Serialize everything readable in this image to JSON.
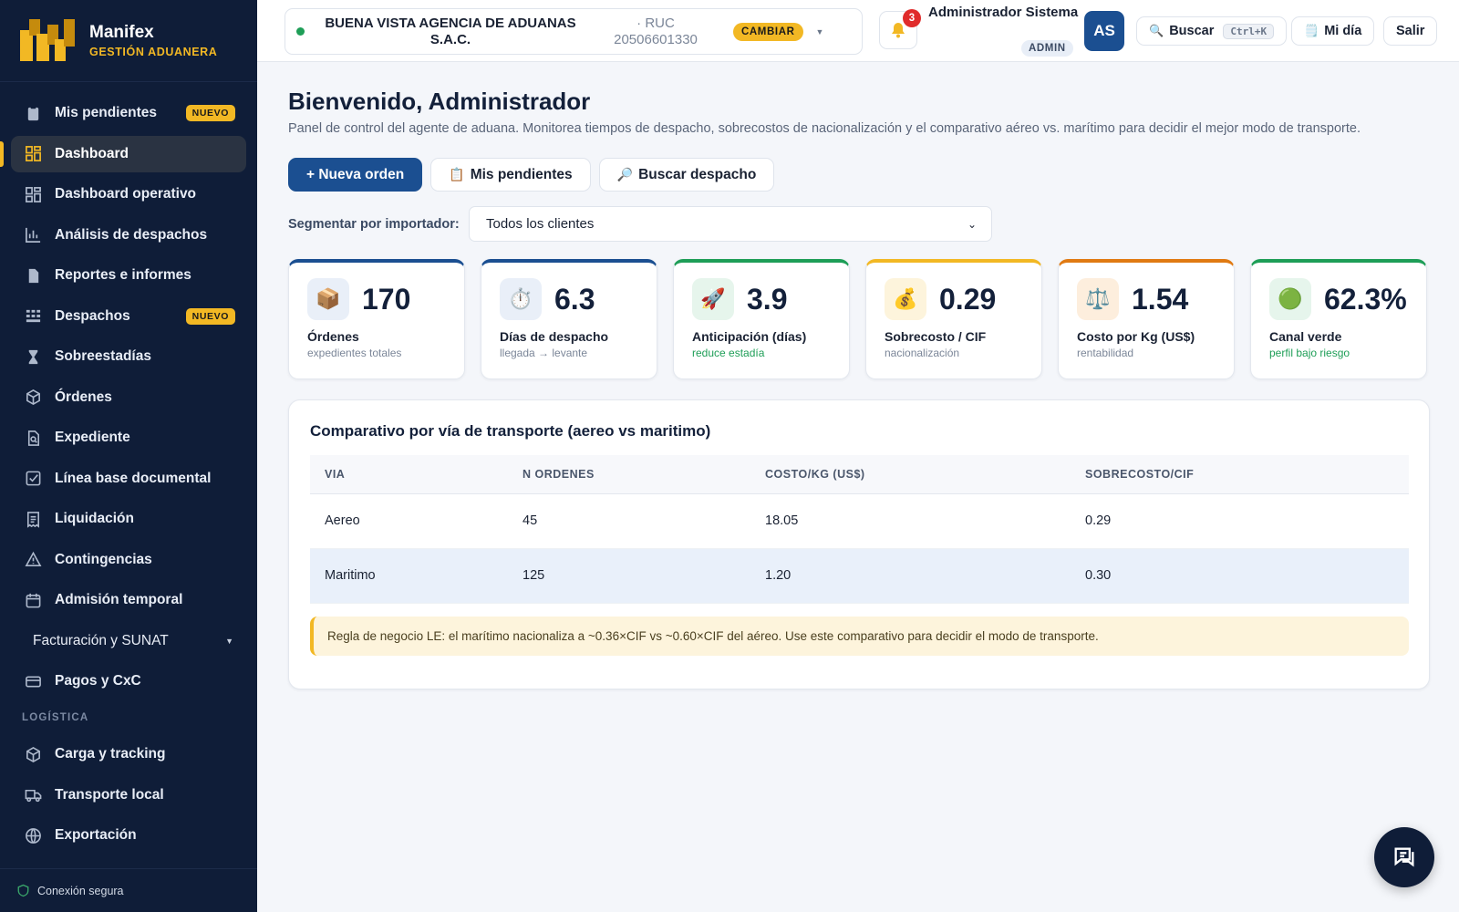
{
  "brand": {
    "name": "Manifex",
    "subtitle": "GESTIÓN ADUANERA"
  },
  "sidebar": {
    "items": [
      {
        "label": "Mis pendientes",
        "icon": "clipboard-icon",
        "badge": "NUEVO"
      },
      {
        "label": "Dashboard",
        "icon": "grid-icon",
        "active": true
      },
      {
        "label": "Dashboard operativo",
        "icon": "grid-icon"
      },
      {
        "label": "Análisis de despachos",
        "icon": "bar-chart-icon"
      },
      {
        "label": "Reportes e informes",
        "icon": "document-icon"
      },
      {
        "label": "Despachos",
        "icon": "boxes-icon",
        "badge": "NUEVO"
      },
      {
        "label": "Sobreestadías",
        "icon": "hourglass-icon"
      },
      {
        "label": "Órdenes",
        "icon": "cube-icon"
      },
      {
        "label": "Expediente",
        "icon": "file-search-icon"
      },
      {
        "label": "Línea base documental",
        "icon": "checkbox-icon"
      },
      {
        "label": "Liquidación",
        "icon": "receipt-icon"
      },
      {
        "label": "Contingencias",
        "icon": "warning-icon"
      },
      {
        "label": "Admisión temporal",
        "icon": "calendar-icon"
      }
    ],
    "submenu": {
      "label": "Facturación y SUNAT"
    },
    "payments": {
      "label": "Pagos y CxC",
      "icon": "credit-card-icon"
    },
    "section_logistics": "LOGÍSTICA",
    "logistics_items": [
      {
        "label": "Carga y tracking",
        "icon": "cube-icon"
      },
      {
        "label": "Transporte local",
        "icon": "truck-icon"
      },
      {
        "label": "Exportación",
        "icon": "globe-icon"
      }
    ],
    "footer": "Conexión segura"
  },
  "topbar": {
    "client_name": "BUENA VISTA AGENCIA DE ADUANAS S.A.C.",
    "client_ruc": "· RUC 20506601330",
    "change_label": "CAMBIAR",
    "notifications": "3",
    "user_name": "Administrador Sistema",
    "user_role": "ADMIN",
    "avatar": "AS",
    "search_label": "Buscar",
    "search_shortcut": "Ctrl+K",
    "myday_label": "Mi día",
    "logout_label": "Salir"
  },
  "page": {
    "title": "Bienvenido, Administrador",
    "subtitle": "Panel de control del agente de aduana. Monitorea tiempos de despacho, sobrecostos de nacionalización y el comparativo aéreo vs. marítimo para decidir el mejor modo de transporte.",
    "actions": {
      "new_order": "+ Nueva orden",
      "pending": "Mis pendientes",
      "search": "Buscar despacho"
    },
    "segment_label": "Segmentar por importador:",
    "segment_value": "Todos los clientes"
  },
  "kpis": [
    {
      "value": "170",
      "label": "Órdenes",
      "hint": "expedientes totales",
      "icon": "📦",
      "accent": "#1b4f91",
      "icon_bg": "#e9eff8",
      "hint_green": false
    },
    {
      "value": "6.3",
      "label": "Días de despacho",
      "hint": "llegada → levante",
      "icon": "⏱️",
      "accent": "#1b4f91",
      "icon_bg": "#e9eff8",
      "hint_green": false
    },
    {
      "value": "3.9",
      "label": "Anticipación (días)",
      "hint": "reduce estadía",
      "icon": "🚀",
      "accent": "#1e9e57",
      "icon_bg": "#e6f5ec",
      "hint_green": true
    },
    {
      "value": "0.29",
      "label": "Sobrecosto / CIF",
      "hint": "nacionalización",
      "icon": "💰",
      "accent": "#f2b824",
      "icon_bg": "#fdf4dc",
      "hint_green": false
    },
    {
      "value": "1.54",
      "label": "Costo por Kg (US$)",
      "hint": "rentabilidad",
      "icon": "⚖️",
      "accent": "#e07a12",
      "icon_bg": "#fdeedd",
      "hint_green": false
    },
    {
      "value": "62.3%",
      "label": "Canal verde",
      "hint": "perfil bajo riesgo",
      "icon": "🟢",
      "accent": "#1e9e57",
      "icon_bg": "#e6f5ec",
      "hint_green": true
    }
  ],
  "comparison": {
    "title": "Comparativo por vía de transporte (aereo vs maritimo)",
    "headers": [
      "VIA",
      "N ORDENES",
      "COSTO/KG (US$)",
      "SOBRECOSTO/CIF"
    ],
    "rows": [
      [
        "Aereo",
        "45",
        "18.05",
        "0.29"
      ],
      [
        "Maritimo",
        "125",
        "1.20",
        "0.30"
      ]
    ],
    "note": "Regla de negocio LE: el marítimo nacionaliza a ~0.36×CIF vs ~0.60×CIF del aéreo. Use este comparativo para decidir el modo de transporte."
  }
}
